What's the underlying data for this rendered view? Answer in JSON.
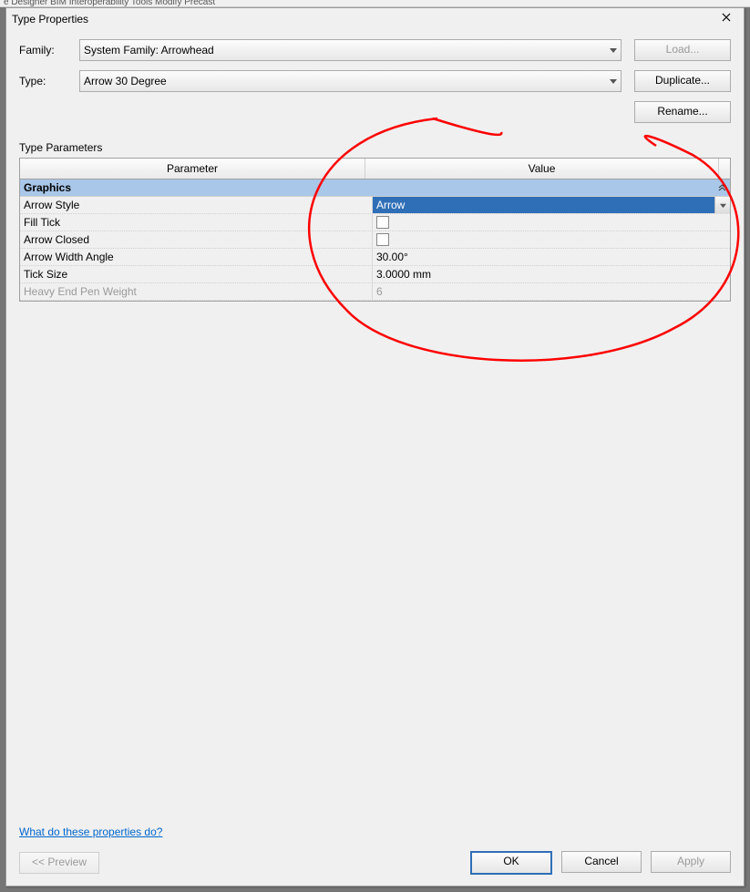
{
  "menubar_fragment": "e Designer    BIM Interoperability Tools    Modify    Precast",
  "dialog": {
    "title": "Type Properties",
    "family_label": "Family:",
    "family_value": "System Family: Arrowhead",
    "type_label": "Type:",
    "type_value": "Arrow 30 Degree",
    "buttons": {
      "load": "Load...",
      "duplicate": "Duplicate...",
      "rename": "Rename..."
    },
    "section_label": "Type Parameters",
    "columns": {
      "param": "Parameter",
      "value": "Value"
    },
    "group": "Graphics",
    "rows": {
      "arrow_style": {
        "label": "Arrow Style",
        "value": "Arrow"
      },
      "fill_tick": {
        "label": "Fill Tick"
      },
      "arrow_closed": {
        "label": "Arrow Closed"
      },
      "arrow_width_angle": {
        "label": "Arrow Width Angle",
        "value": "30.00°"
      },
      "tick_size": {
        "label": "Tick Size",
        "value": "3.0000 mm"
      },
      "heavy_end": {
        "label": "Heavy End Pen Weight",
        "value": "6"
      }
    },
    "help_link": "What do these properties do?",
    "footer": {
      "preview": "<< Preview",
      "ok": "OK",
      "cancel": "Cancel",
      "apply": "Apply"
    }
  }
}
